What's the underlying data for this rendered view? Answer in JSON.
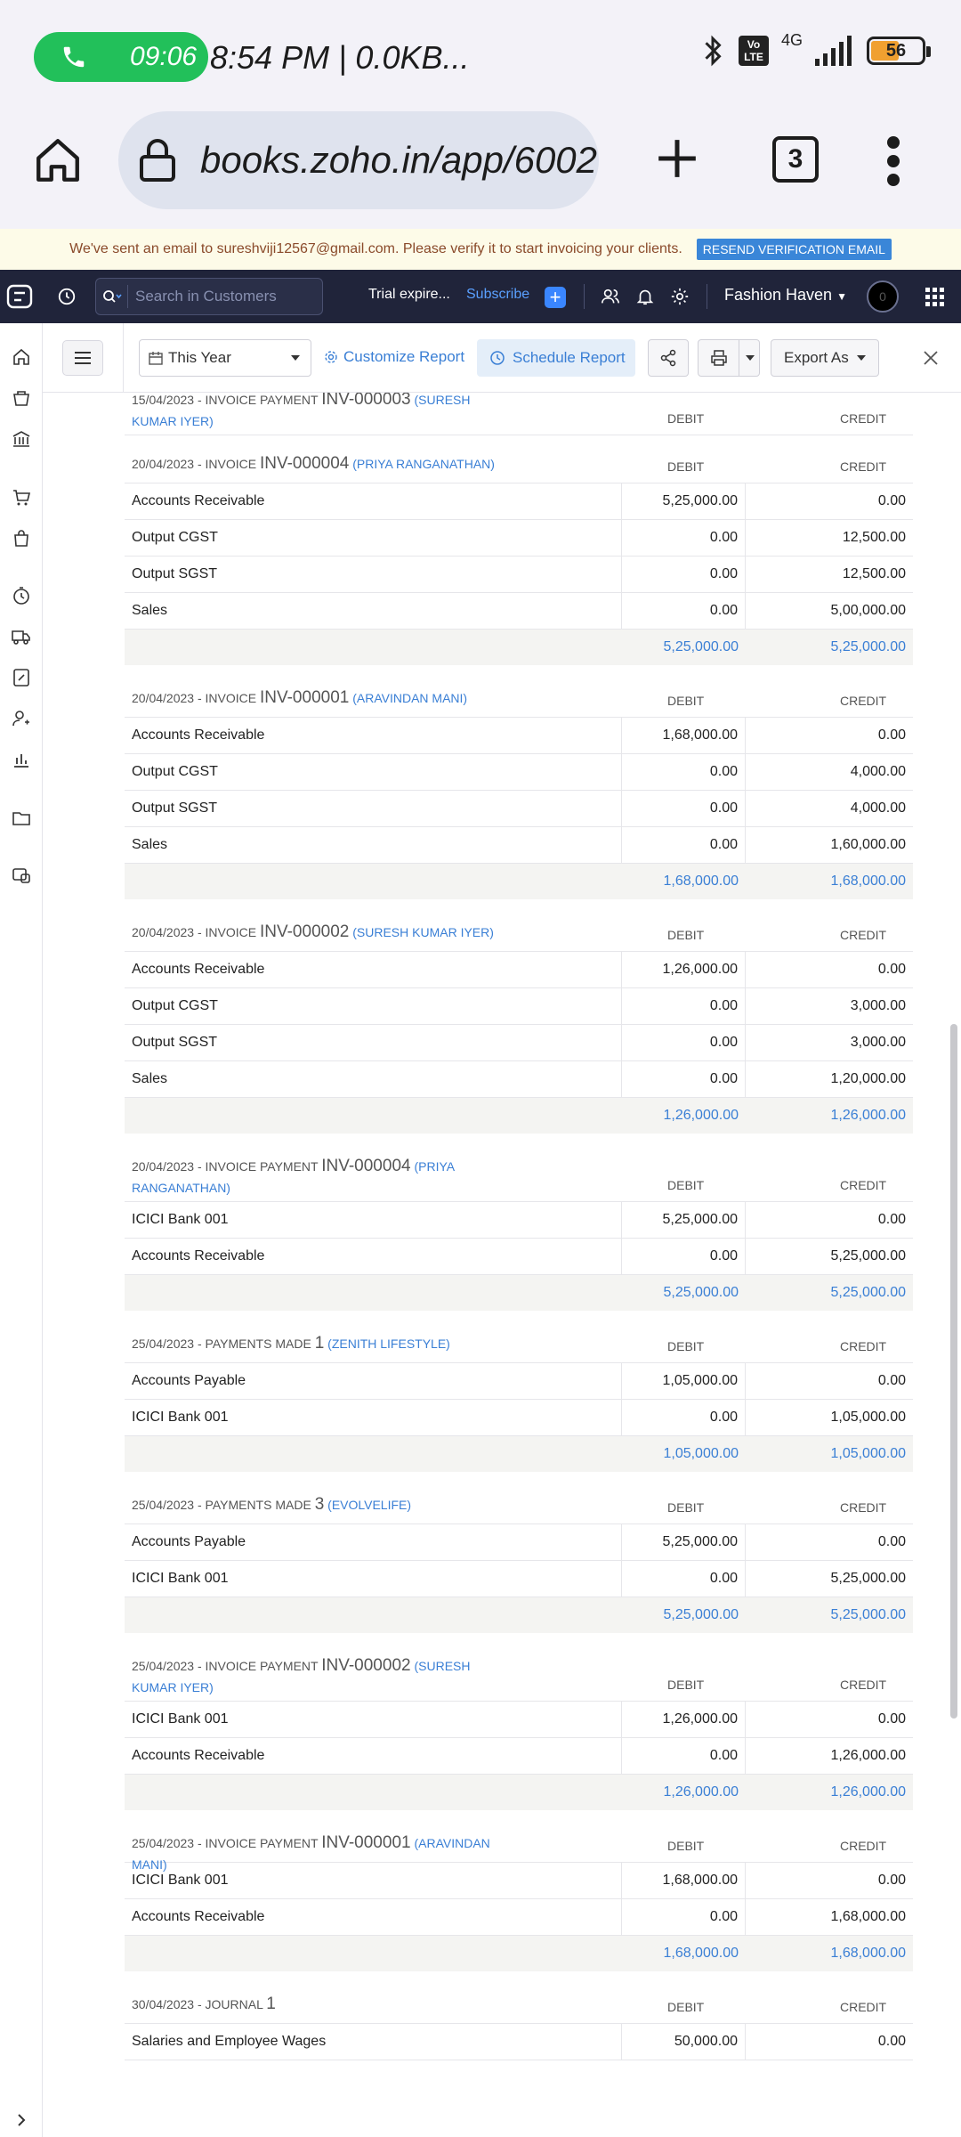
{
  "status_bar": {
    "call_time": "09:06",
    "status_text": "8:54 PM | 0.0KB...",
    "volte": "Vo LTE",
    "network": "4G",
    "battery_level": 56
  },
  "browser": {
    "url": "books.zoho.in/app/6002",
    "tabs_count": "3"
  },
  "banner": {
    "message": "We've sent an email to sureshviji12567@gmail.com. Please verify it to start invoicing your clients.",
    "button_label": "RESEND VERIFICATION EMAIL"
  },
  "header": {
    "search_placeholder": "Search in Customers",
    "trial_text": "Trial expire...",
    "subscribe_label": "Subscribe",
    "org_name": "Fashion Haven",
    "avatar_initial": "0"
  },
  "toolbar": {
    "period": "This Year",
    "customize_label": "Customize Report",
    "schedule_label": "Schedule Report",
    "export_label": "Export As"
  },
  "colors": {
    "accent": "#3a7fd5",
    "header_bg": "#20243a",
    "call_green": "#22c05a",
    "banner_bg": "#fdfbe8"
  },
  "report": {
    "debit_label": "DEBIT",
    "credit_label": "CREDIT",
    "entries": [
      {
        "date": "15/04/2023 -",
        "type": "INVOICE PAYMENT",
        "number": "INV-000003",
        "party": "(SURESH KUMAR IYER)",
        "rows": [],
        "total": null
      },
      {
        "date": "20/04/2023 -",
        "type": "INVOICE",
        "number": "INV-000004",
        "party": "(PRIYA RANGANATHAN)",
        "rows": [
          {
            "account": "Accounts Receivable",
            "debit": "5,25,000.00",
            "credit": "0.00"
          },
          {
            "account": "Output CGST",
            "debit": "0.00",
            "credit": "12,500.00"
          },
          {
            "account": "Output SGST",
            "debit": "0.00",
            "credit": "12,500.00"
          },
          {
            "account": "Sales",
            "debit": "0.00",
            "credit": "5,00,000.00"
          }
        ],
        "total": {
          "debit": "5,25,000.00",
          "credit": "5,25,000.00"
        }
      },
      {
        "date": "20/04/2023 -",
        "type": "INVOICE",
        "number": "INV-000001",
        "party": "(ARAVINDAN MANI)",
        "rows": [
          {
            "account": "Accounts Receivable",
            "debit": "1,68,000.00",
            "credit": "0.00"
          },
          {
            "account": "Output CGST",
            "debit": "0.00",
            "credit": "4,000.00"
          },
          {
            "account": "Output SGST",
            "debit": "0.00",
            "credit": "4,000.00"
          },
          {
            "account": "Sales",
            "debit": "0.00",
            "credit": "1,60,000.00"
          }
        ],
        "total": {
          "debit": "1,68,000.00",
          "credit": "1,68,000.00"
        }
      },
      {
        "date": "20/04/2023 -",
        "type": "INVOICE",
        "number": "INV-000002",
        "party": "(SURESH KUMAR IYER)",
        "rows": [
          {
            "account": "Accounts Receivable",
            "debit": "1,26,000.00",
            "credit": "0.00"
          },
          {
            "account": "Output CGST",
            "debit": "0.00",
            "credit": "3,000.00"
          },
          {
            "account": "Output SGST",
            "debit": "0.00",
            "credit": "3,000.00"
          },
          {
            "account": "Sales",
            "debit": "0.00",
            "credit": "1,20,000.00"
          }
        ],
        "total": {
          "debit": "1,26,000.00",
          "credit": "1,26,000.00"
        }
      },
      {
        "date": "20/04/2023 -",
        "type": "INVOICE PAYMENT",
        "number": "INV-000004",
        "party": "(PRIYA RANGANATHAN)",
        "rows": [
          {
            "account": "ICICI Bank 001",
            "debit": "5,25,000.00",
            "credit": "0.00"
          },
          {
            "account": "Accounts Receivable",
            "debit": "0.00",
            "credit": "5,25,000.00"
          }
        ],
        "total": {
          "debit": "5,25,000.00",
          "credit": "5,25,000.00"
        }
      },
      {
        "date": "25/04/2023 -",
        "type": "PAYMENTS MADE",
        "number": "1",
        "party": "(ZENITH LIFESTYLE)",
        "rows": [
          {
            "account": "Accounts Payable",
            "debit": "1,05,000.00",
            "credit": "0.00"
          },
          {
            "account": "ICICI Bank 001",
            "debit": "0.00",
            "credit": "1,05,000.00"
          }
        ],
        "total": {
          "debit": "1,05,000.00",
          "credit": "1,05,000.00"
        }
      },
      {
        "date": "25/04/2023 -",
        "type": "PAYMENTS MADE",
        "number": "3",
        "party": "(EVOLVELIFE)",
        "rows": [
          {
            "account": "Accounts Payable",
            "debit": "5,25,000.00",
            "credit": "0.00"
          },
          {
            "account": "ICICI Bank 001",
            "debit": "0.00",
            "credit": "5,25,000.00"
          }
        ],
        "total": {
          "debit": "5,25,000.00",
          "credit": "5,25,000.00"
        }
      },
      {
        "date": "25/04/2023 -",
        "type": "INVOICE PAYMENT",
        "number": "INV-000002",
        "party": "(SURESH KUMAR IYER)",
        "rows": [
          {
            "account": "ICICI Bank 001",
            "debit": "1,26,000.00",
            "credit": "0.00"
          },
          {
            "account": "Accounts Receivable",
            "debit": "0.00",
            "credit": "1,26,000.00"
          }
        ],
        "total": {
          "debit": "1,26,000.00",
          "credit": "1,26,000.00"
        }
      },
      {
        "date": "25/04/2023 -",
        "type": "INVOICE PAYMENT",
        "number": "INV-000001",
        "party": "(ARAVINDAN MANI)",
        "rows": [
          {
            "account": "ICICI Bank 001",
            "debit": "1,68,000.00",
            "credit": "0.00"
          },
          {
            "account": "Accounts Receivable",
            "debit": "0.00",
            "credit": "1,68,000.00"
          }
        ],
        "total": {
          "debit": "1,68,000.00",
          "credit": "1,68,000.00"
        }
      },
      {
        "date": "30/04/2023 -",
        "type": "JOURNAL",
        "number": "1",
        "party": "",
        "rows": [
          {
            "account": "Salaries and Employee Wages",
            "debit": "50,000.00",
            "credit": "0.00"
          }
        ],
        "total": null
      }
    ]
  }
}
